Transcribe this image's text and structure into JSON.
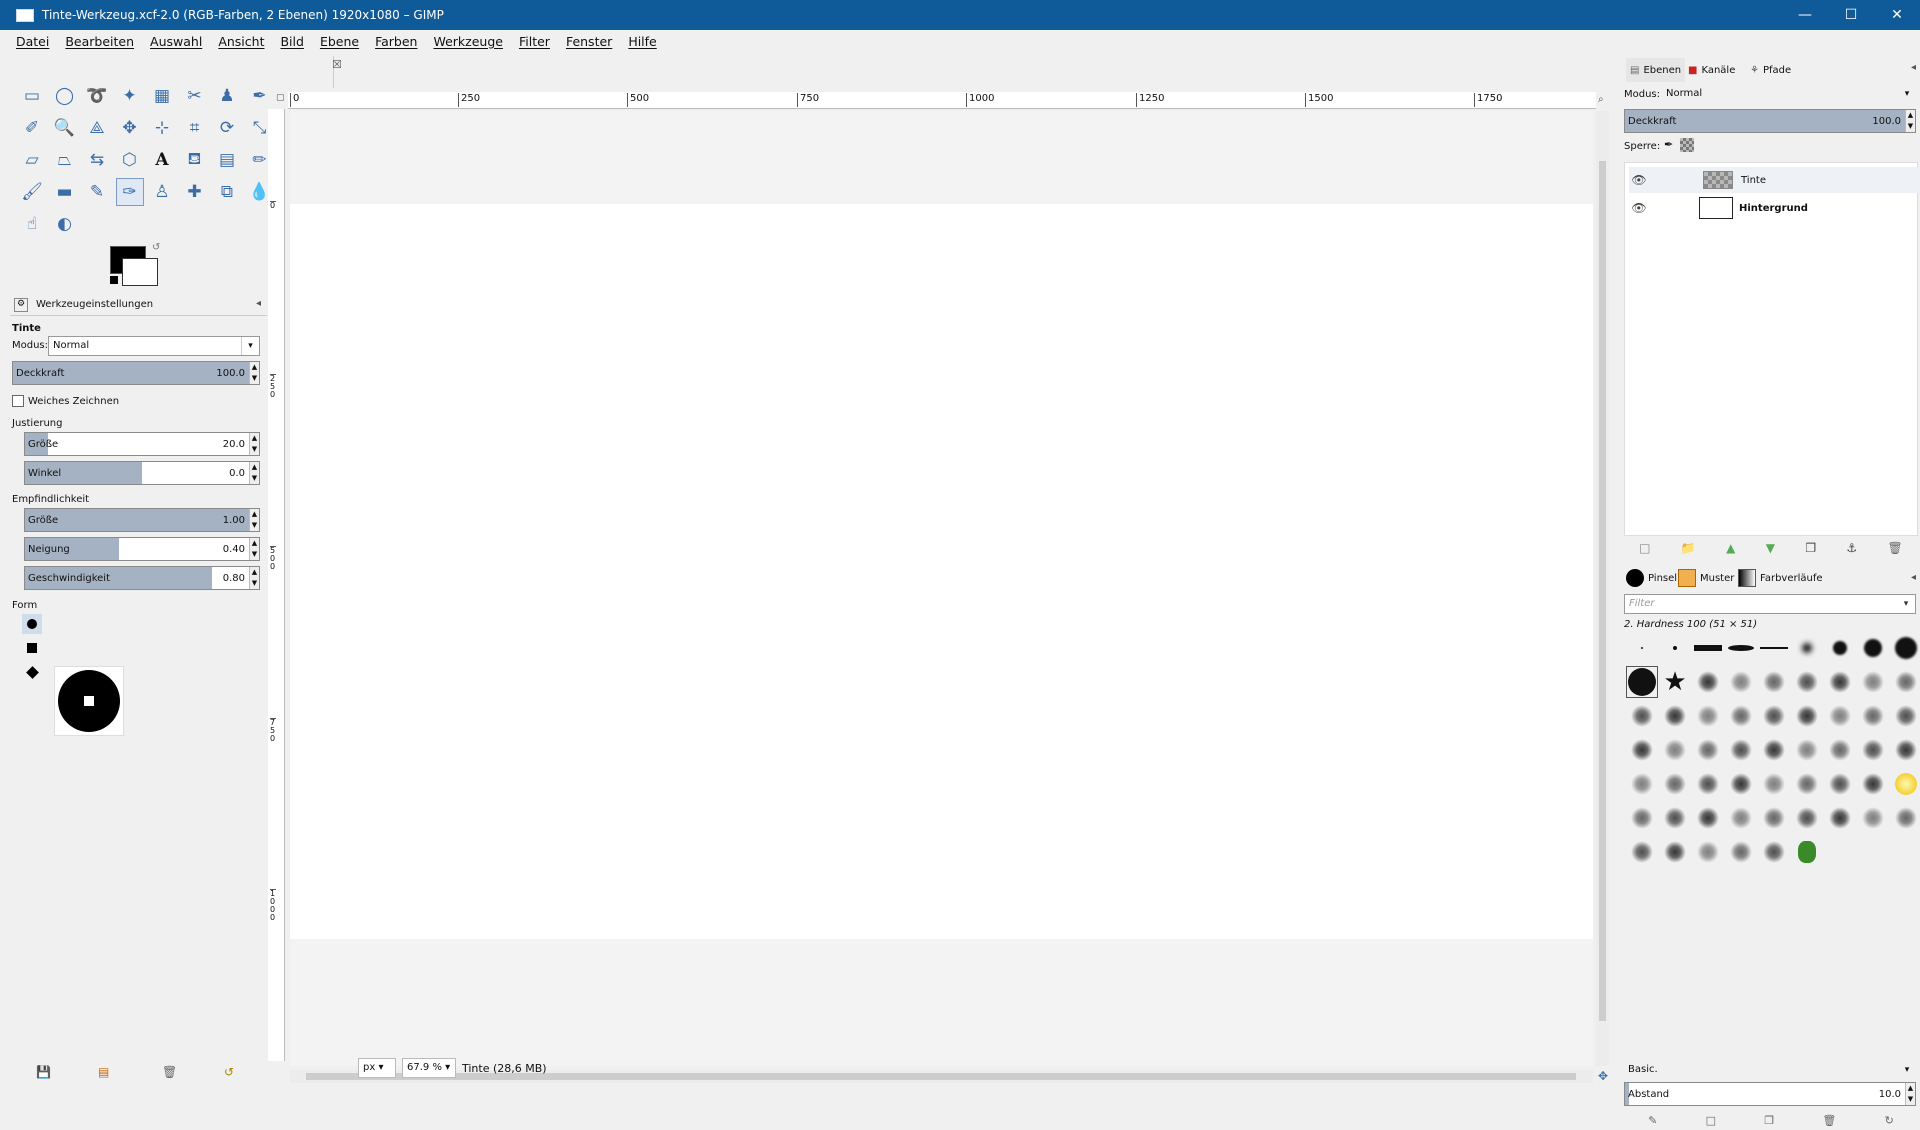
{
  "window": {
    "title": "Tinte-Werkzeug.xcf-2.0 (RGB-Farben, 2 Ebenen) 1920x1080 – GIMP"
  },
  "menubar": [
    "Datei",
    "Bearbeiten",
    "Auswahl",
    "Ansicht",
    "Bild",
    "Ebene",
    "Farben",
    "Werkzeuge",
    "Filter",
    "Fenster",
    "Hilfe"
  ],
  "toolbox": {
    "tools": [
      "rect-select-icon",
      "ellipse-select-icon",
      "lasso-icon",
      "fuzzy-select-icon",
      "color-select-icon",
      "scissors-icon",
      "foreground-select-icon",
      "paths-icon",
      "color-picker-icon",
      "zoom-icon",
      "measure-icon",
      "move-icon",
      "align-icon",
      "crop-icon",
      "rotate-icon",
      "scale-icon",
      "shear-icon",
      "perspective-icon",
      "flip-icon",
      "cage-icon",
      "text-icon",
      "bucket-fill-icon",
      "gradient-icon",
      "pencil-icon",
      "paintbrush-icon",
      "eraser-icon",
      "airbrush-icon",
      "ink-icon",
      "clone-icon",
      "heal-icon",
      "perspective-clone-icon",
      "blur-icon",
      "smudge-icon",
      "dodge-burn-icon"
    ],
    "active_tool": "ink-icon"
  },
  "tool_options": {
    "tab_label": "Werkzeugeinstellungen",
    "tool_name": "Tinte",
    "mode_label": "Modus:",
    "mode_value": "Normal",
    "opacity_label": "Deckkraft",
    "opacity_value": "100.0",
    "opacity_fraction": 1.0,
    "antialias_label": "Weiches Zeichnen",
    "adjustment_label": "Justierung",
    "size_label": "Größe",
    "size_value": "20.0",
    "size_fraction": 0.1,
    "angle_label": "Winkel",
    "angle_value": "0.0",
    "angle_fraction": 0.5,
    "sensitivity_label": "Empfindlichkeit",
    "sens_size_label": "Größe",
    "sens_size_value": "1.00",
    "sens_size_fraction": 1.0,
    "tilt_label": "Neigung",
    "tilt_value": "0.40",
    "tilt_fraction": 0.4,
    "speed_label": "Geschwindigkeit",
    "speed_value": "0.80",
    "speed_fraction": 0.8,
    "shape_label": "Form"
  },
  "ruler": {
    "h_labels": [
      "0",
      "250",
      "500",
      "750",
      "1000",
      "1250",
      "1500",
      "1750"
    ],
    "v_labels": [
      "0",
      "250",
      "500",
      "750",
      "1000"
    ]
  },
  "statusbar": {
    "unit": "px",
    "zoom": "67.9 %",
    "info": "Tinte (28,6 MB)"
  },
  "layers_panel": {
    "tabs": [
      "Ebenen",
      "Kanäle",
      "Pfade"
    ],
    "mode_label": "Modus:",
    "mode_value": "Normal",
    "opacity_label": "Deckkraft",
    "opacity_value": "100.0",
    "lock_label": "Sperre:",
    "layers": [
      {
        "name": "Tinte",
        "bold": false
      },
      {
        "name": "Hintergrund",
        "bold": true
      }
    ]
  },
  "brushes_panel": {
    "tabs": [
      "Pinsel",
      "Muster",
      "Farbverläufe"
    ],
    "filter_placeholder": "Filter",
    "selected_brush": "2. Hardness 100 (51 × 51)",
    "preset": "Basic.",
    "spacing_label": "Abstand",
    "spacing_value": "10.0"
  },
  "colors": {
    "titlebar": "#0f5a98",
    "slider_fill": "#a4b2c3",
    "accent": "#3b6ea8"
  }
}
